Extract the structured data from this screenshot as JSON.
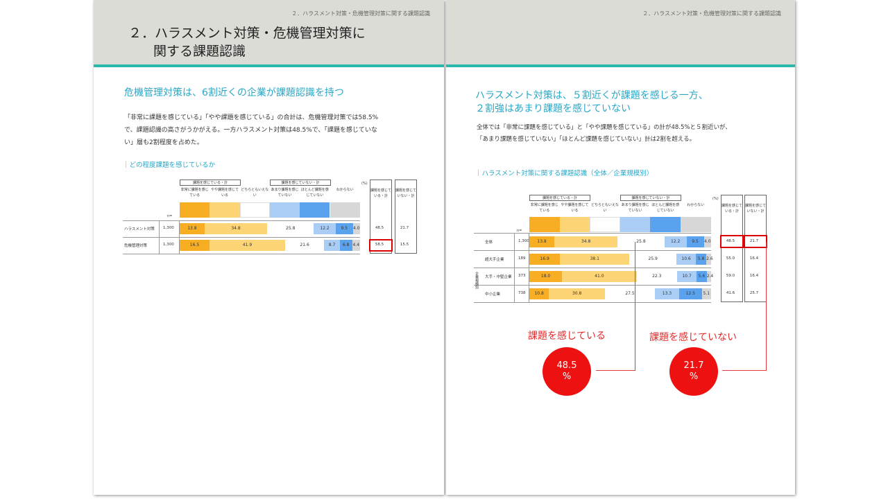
{
  "left": {
    "running_head": "２．ハラスメント対策・危機管理対策に関する課題認識",
    "chapter_title_1": "２．ハラスメント対策・危機管理対策に",
    "chapter_title_2": "関する課題認識",
    "section_title": "危機管理対策は、6割近くの企業が課題認識を持つ",
    "body_1": "「非常に課題を感じている」「やや課題を感じている」の合計は、危機管理対策では58.5%",
    "body_2": "で、課題認識の高さがうかがえる。一方ハラスメント対策は48.5%で、「課題を感じていな",
    "body_3": "い」層も2割程度を占めた。",
    "chart_title": "｜どの程度課題を感じているか",
    "group_have": "課題を感じている・計",
    "group_not": "課題を感じていない・計",
    "percent_unit": "(%)",
    "n_label": "n=",
    "cols": [
      "非常に課題を感じている",
      "やや課題を感じている",
      "どちらともいえない",
      "あまり課題を感じていない",
      "ほとんど課題を感じていない",
      "わからない"
    ],
    "sum_cols": [
      "課題を感じている・計",
      "課題を感じていない・計"
    ],
    "rows": [
      {
        "label": "ハラスメント対策",
        "n": "1,300",
        "values": [
          "13.8",
          "34.8",
          "25.8",
          "12.2",
          "9.5",
          "4.0"
        ],
        "sum1": "48.5",
        "sum2": "21.7"
      },
      {
        "label": "危機管理対策",
        "n": "1,300",
        "values": [
          "16.5",
          "41.9",
          "21.6",
          "8.7",
          "6.8",
          "4.4"
        ],
        "sum1": "58.5",
        "sum2": "15.5"
      }
    ]
  },
  "right": {
    "running_head": "２．ハラスメント対策・危機管理対策に関する課題認識",
    "section_title_1": "ハラスメント対策は、５割近くが課題を感じる一方、",
    "section_title_2": "２割強はあまり課題を感じていない",
    "body_1": "全体では「非常に課題を感じている」と「やや課題を感じている」の計が48.5%と５割近いが、",
    "body_2": "「あまり課題を感じていない」「ほとんど課題を感じていない」計は2割を超える。",
    "chart_title": "｜ハラスメント対策に関する課題認識（全体／企業規模別）",
    "group_have": "課題を感じている・計",
    "group_not": "課題を感じていない・計",
    "percent_unit": "(%)",
    "n_label": "n=",
    "side_label": "企業規模別",
    "cols": [
      "非常に課題を感じている",
      "やや課題を感じている",
      "どちらともいえない",
      "あまり課題を感じていない",
      "ほとんど課題を感じていない",
      "わからない"
    ],
    "sum_cols": [
      "課題を感じている・計",
      "課題を感じていない・計"
    ],
    "rows": [
      {
        "label": "全体",
        "n": "1,300",
        "values": [
          "13.8",
          "34.8",
          "25.8",
          "12.2",
          "9.5",
          "4.0"
        ],
        "sum1": "48.5",
        "sum2": "21.7"
      },
      {
        "label": "超大手企業",
        "n": "189",
        "values": [
          "16.9",
          "38.1",
          "25.9",
          "10.6",
          "5.8",
          "2.6"
        ],
        "sum1": "55.0",
        "sum2": "16.4"
      },
      {
        "label": "大手・中堅企業",
        "n": "373",
        "values": [
          "18.0",
          "41.0",
          "22.3",
          "10.7",
          "5.6",
          "2.4"
        ],
        "sum1": "59.0",
        "sum2": "16.4"
      },
      {
        "label": "中小企業",
        "n": "738",
        "values": [
          "10.8",
          "30.8",
          "27.5",
          "13.3",
          "12.5",
          "5.1"
        ],
        "sum1": "41.6",
        "sum2": "25.7"
      }
    ],
    "callout_have_label": "課題を感じている",
    "callout_not_label": "課題を感じていない",
    "callout_have_value": "48.5",
    "callout_not_value": "21.7",
    "callout_unit": "%"
  },
  "colors": {
    "c1": "#f7ae23",
    "c2": "#fdd476",
    "c3": "#ffffff",
    "c4": "#a9cdf5",
    "c5": "#5aa2ee",
    "c6": "#d7d7d7",
    "accent_teal": "#2bb8ac",
    "title_blue": "#2aa7c7",
    "red": "#ee1111"
  }
}
